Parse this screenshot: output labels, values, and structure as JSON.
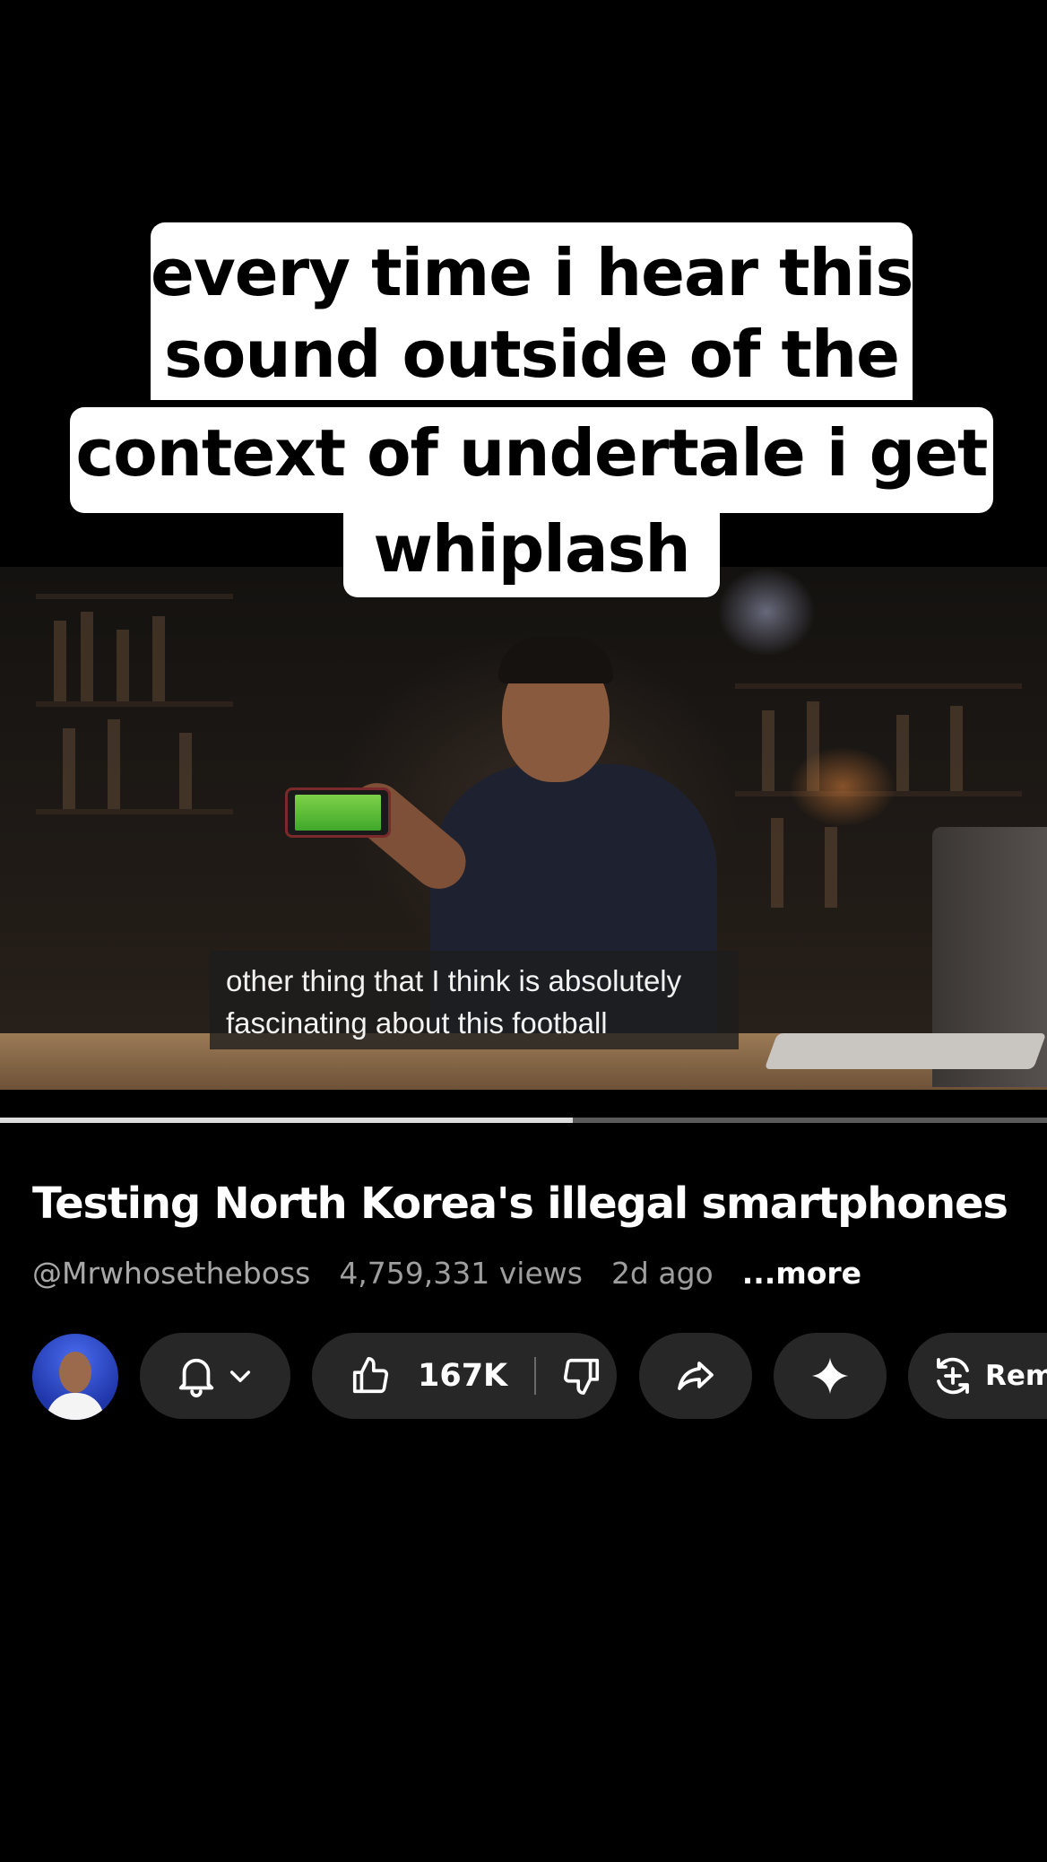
{
  "caption": {
    "lines": [
      "every time i hear this",
      "sound outside of the",
      "context of undertale i get",
      "whiplash"
    ]
  },
  "video": {
    "subtitle_lines": [
      "other thing that I think is absolutely",
      "fascinating about this football"
    ],
    "progress_fraction": 0.547
  },
  "info": {
    "title": "Testing North Korea's illegal smartphones",
    "channel": "@Mrwhosetheboss",
    "views": "4,759,331 views",
    "age": "2d ago",
    "more_label": "...more"
  },
  "actions": {
    "avatar_icon": "channel-avatar",
    "subscribe_icon": "bell-icon",
    "like_count": "167K",
    "like_icon": "thumbs-up-icon",
    "dislike_icon": "thumbs-down-icon",
    "share_icon": "share-icon",
    "ask_icon": "sparkle-icon",
    "remix_label": "Remi",
    "remix_icon": "remix-icon"
  },
  "colors": {
    "background": "#000000",
    "pill": "#272727",
    "caption_bg": "#ffffff",
    "meta_text": "#9e9e9e"
  }
}
